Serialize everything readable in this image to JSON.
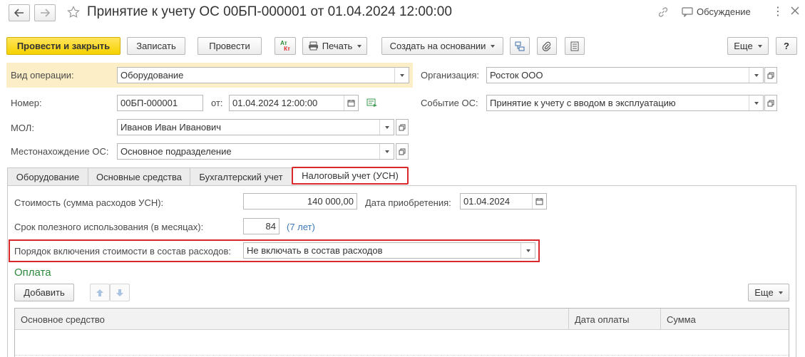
{
  "window": {
    "title": "Принятие к учету ОС 00БП-000001 от 01.04.2024 12:00:00",
    "discussion_label": "Обсуждение"
  },
  "toolbar": {
    "post_close": "Провести и закрыть",
    "save": "Записать",
    "post": "Провести",
    "dtkt_top": "Ат",
    "dtkt_bottom": "Кт",
    "print": "Печать",
    "create_based": "Создать на основании",
    "more": "Еще",
    "help": "?"
  },
  "form": {
    "operation_label": "Вид операции:",
    "operation_value": "Оборудование",
    "org_label": "Организация:",
    "org_value": "Росток ООО",
    "number_label": "Номер:",
    "number_value": "00БП-000001",
    "date_label": "от:",
    "date_value": "01.04.2024 12:00:00",
    "event_label": "Событие ОС:",
    "event_value": "Принятие к учету с вводом в эксплуатацию",
    "mol_label": "МОЛ:",
    "mol_value": "Иванов Иван Иванович",
    "location_label": "Местонахождение ОС:",
    "location_value": "Основное подразделение"
  },
  "tabs": [
    {
      "label": "Оборудование"
    },
    {
      "label": "Основные средства"
    },
    {
      "label": "Бухгалтерский учет"
    },
    {
      "label": "Налоговый учет (УСН)",
      "active": true
    }
  ],
  "tax": {
    "cost_label": "Стоимость (сумма расходов УСН):",
    "cost_value": "140 000,00",
    "acq_date_label": "Дата приобретения:",
    "acq_date_value": "01.04.2024",
    "life_label": "Срок полезного использования (в месяцах):",
    "life_value": "84",
    "life_hint": "(7 лет)",
    "order_label": "Порядок включения стоимости в состав расходов:",
    "order_value": "Не включать в состав расходов",
    "payment_title": "Оплата",
    "add_button": "Добавить",
    "more_button": "Еще",
    "columns": [
      "Основное средство",
      "Дата оплаты",
      "Сумма"
    ]
  },
  "colors": {
    "accent_yellow": "#f6d200",
    "highlight_band": "#fcefc7",
    "highlight_red": "#d9292b",
    "link_green": "#2f8a3b",
    "hint_blue": "#3e78b8"
  }
}
